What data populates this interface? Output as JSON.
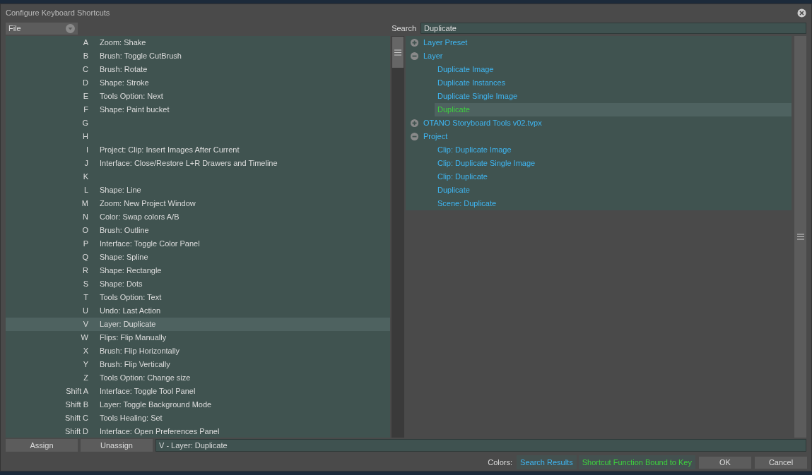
{
  "window": {
    "title": "Configure Keyboard Shortcuts"
  },
  "category": {
    "value": "File"
  },
  "search": {
    "label": "Search",
    "value": "Duplicate"
  },
  "shortcuts": [
    {
      "key": "A",
      "action": "Zoom: Shake",
      "selected": false
    },
    {
      "key": "B",
      "action": "Brush: Toggle CutBrush",
      "selected": false
    },
    {
      "key": "C",
      "action": "Brush: Rotate",
      "selected": false
    },
    {
      "key": "D",
      "action": "Shape: Stroke",
      "selected": false
    },
    {
      "key": "E",
      "action": "Tools Option: Next",
      "selected": false
    },
    {
      "key": "F",
      "action": "Shape: Paint bucket",
      "selected": false
    },
    {
      "key": "G",
      "selected": false
    },
    {
      "key": "H",
      "selected": false
    },
    {
      "key": "I",
      "action": "Project: Clip: Insert Images After Current",
      "selected": false
    },
    {
      "key": "J",
      "action": "Interface: Close/Restore L+R Drawers and Timeline",
      "selected": false
    },
    {
      "key": "K",
      "selected": false
    },
    {
      "key": "L",
      "action": "Shape: Line",
      "selected": false
    },
    {
      "key": "M",
      "action": "Zoom: New Project Window",
      "selected": false
    },
    {
      "key": "N",
      "action": "Color: Swap colors A/B",
      "selected": false
    },
    {
      "key": "O",
      "action": "Brush: Outline",
      "selected": false
    },
    {
      "key": "P",
      "action": "Interface: Toggle Color Panel",
      "selected": false
    },
    {
      "key": "Q",
      "action": "Shape: Spline",
      "selected": false
    },
    {
      "key": "R",
      "action": "Shape: Rectangle",
      "selected": false
    },
    {
      "key": "S",
      "action": "Shape: Dots",
      "selected": false
    },
    {
      "key": "T",
      "action": "Tools Option: Text",
      "selected": false
    },
    {
      "key": "U",
      "action": "Undo: Last Action",
      "selected": false
    },
    {
      "key": "V",
      "action": "Layer: Duplicate",
      "selected": true
    },
    {
      "key": "W",
      "action": "Flips: Flip Manually",
      "selected": false
    },
    {
      "key": "X",
      "action": "Brush: Flip Horizontally",
      "selected": false
    },
    {
      "key": "Y",
      "action": "Brush: Flip Vertically",
      "selected": false
    },
    {
      "key": "Z",
      "action": "Tools Option: Change size",
      "selected": false
    },
    {
      "key": "Shift A",
      "action": "Interface: Toggle Tool Panel",
      "selected": false
    },
    {
      "key": "Shift B",
      "action": "Layer: Toggle Background Mode",
      "selected": false
    },
    {
      "key": "Shift C",
      "action": "Tools Healing: Set",
      "selected": false
    },
    {
      "key": "Shift D",
      "action": "Interface: Open Preferences Panel",
      "selected": false
    }
  ],
  "functions": [
    {
      "label": "Layer Preset",
      "expanded": false
    },
    {
      "label": "Layer",
      "expanded": true,
      "children": [
        {
          "label": "Duplicate Image",
          "bound": false,
          "selected": false
        },
        {
          "label": "Duplicate Instances",
          "bound": false,
          "selected": false
        },
        {
          "label": "Duplicate Single Image",
          "bound": false,
          "selected": false
        },
        {
          "label": "Duplicate",
          "bound": true,
          "selected": true
        }
      ]
    },
    {
      "label": "OTANO Storyboard Tools v02.tvpx",
      "expanded": false
    },
    {
      "label": "Project",
      "expanded": true,
      "children": [
        {
          "label": "Clip: Duplicate Image",
          "bound": false,
          "selected": false
        },
        {
          "label": "Clip: Duplicate Single Image",
          "bound": false,
          "selected": false
        },
        {
          "label": "Clip: Duplicate",
          "bound": false,
          "selected": false
        },
        {
          "label": "Duplicate",
          "bound": false,
          "selected": false
        },
        {
          "label": "Scene: Duplicate",
          "bound": false,
          "selected": false
        }
      ]
    }
  ],
  "actions": {
    "assign": "Assign",
    "unassign": "Unassign",
    "binding": "V - Layer: Duplicate"
  },
  "legend": {
    "label": "Colors:",
    "items": [
      {
        "label": "Search Results",
        "color": "#3fb6f2"
      },
      {
        "label": "Shortcut Function Bound to Key",
        "color": "#3ed23e"
      }
    ]
  },
  "buttons": [
    "OK",
    "Cancel"
  ]
}
